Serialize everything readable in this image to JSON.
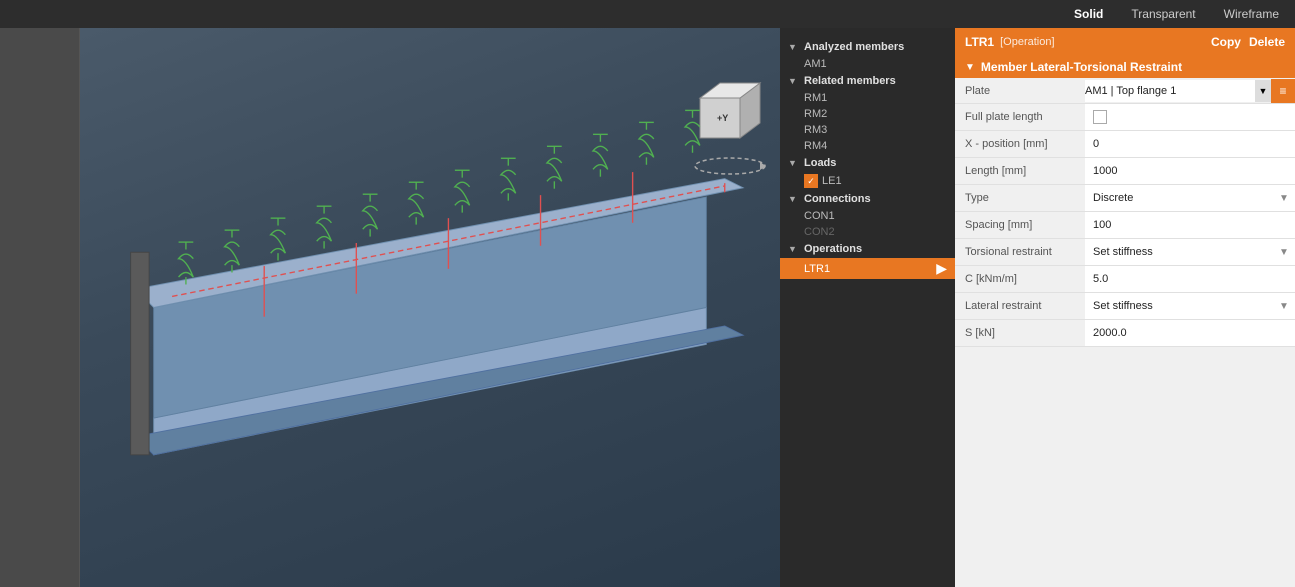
{
  "topbar": {
    "solid": "Solid",
    "transparent": "Transparent",
    "wireframe": "Wireframe",
    "active": "Solid"
  },
  "panel_header": {
    "id": "LTR1",
    "operation": "[Operation]",
    "copy_btn": "Copy",
    "delete_btn": "Delete"
  },
  "section": {
    "title": "Member Lateral-Torsional Restraint",
    "triangle": "▼"
  },
  "properties": [
    {
      "label": "Plate",
      "value": "AM1 | Top flange 1",
      "type": "dropdown"
    },
    {
      "label": "Full plate length",
      "value": "",
      "type": "checkbox"
    },
    {
      "label": "X - position [mm]",
      "value": "0",
      "type": "text"
    },
    {
      "label": "Length [mm]",
      "value": "1000",
      "type": "text"
    },
    {
      "label": "Type",
      "value": "Discrete",
      "type": "dropdown"
    },
    {
      "label": "Spacing [mm]",
      "value": "100",
      "type": "text"
    },
    {
      "label": "Torsional restraint",
      "value": "Set stiffness",
      "type": "dropdown"
    },
    {
      "label": "C [kNm/m]",
      "value": "5.0",
      "type": "text"
    },
    {
      "label": "Lateral restraint",
      "value": "Set stiffness",
      "type": "dropdown"
    },
    {
      "label": "S [kN]",
      "value": "2000.0",
      "type": "text"
    }
  ],
  "tree": {
    "analyzed_members_label": "Analyzed members",
    "analyzed_members": [
      "AM1"
    ],
    "related_members_label": "Related members",
    "related_members": [
      "RM1",
      "RM2",
      "RM3",
      "RM4"
    ],
    "loads_label": "Loads",
    "loads": [
      "LE1"
    ],
    "connections_label": "Connections",
    "connections": [
      "CON1",
      "CON2"
    ],
    "operations_label": "Operations",
    "operations": [
      "LTR1"
    ]
  },
  "cube": {
    "y_label": "+Y"
  }
}
